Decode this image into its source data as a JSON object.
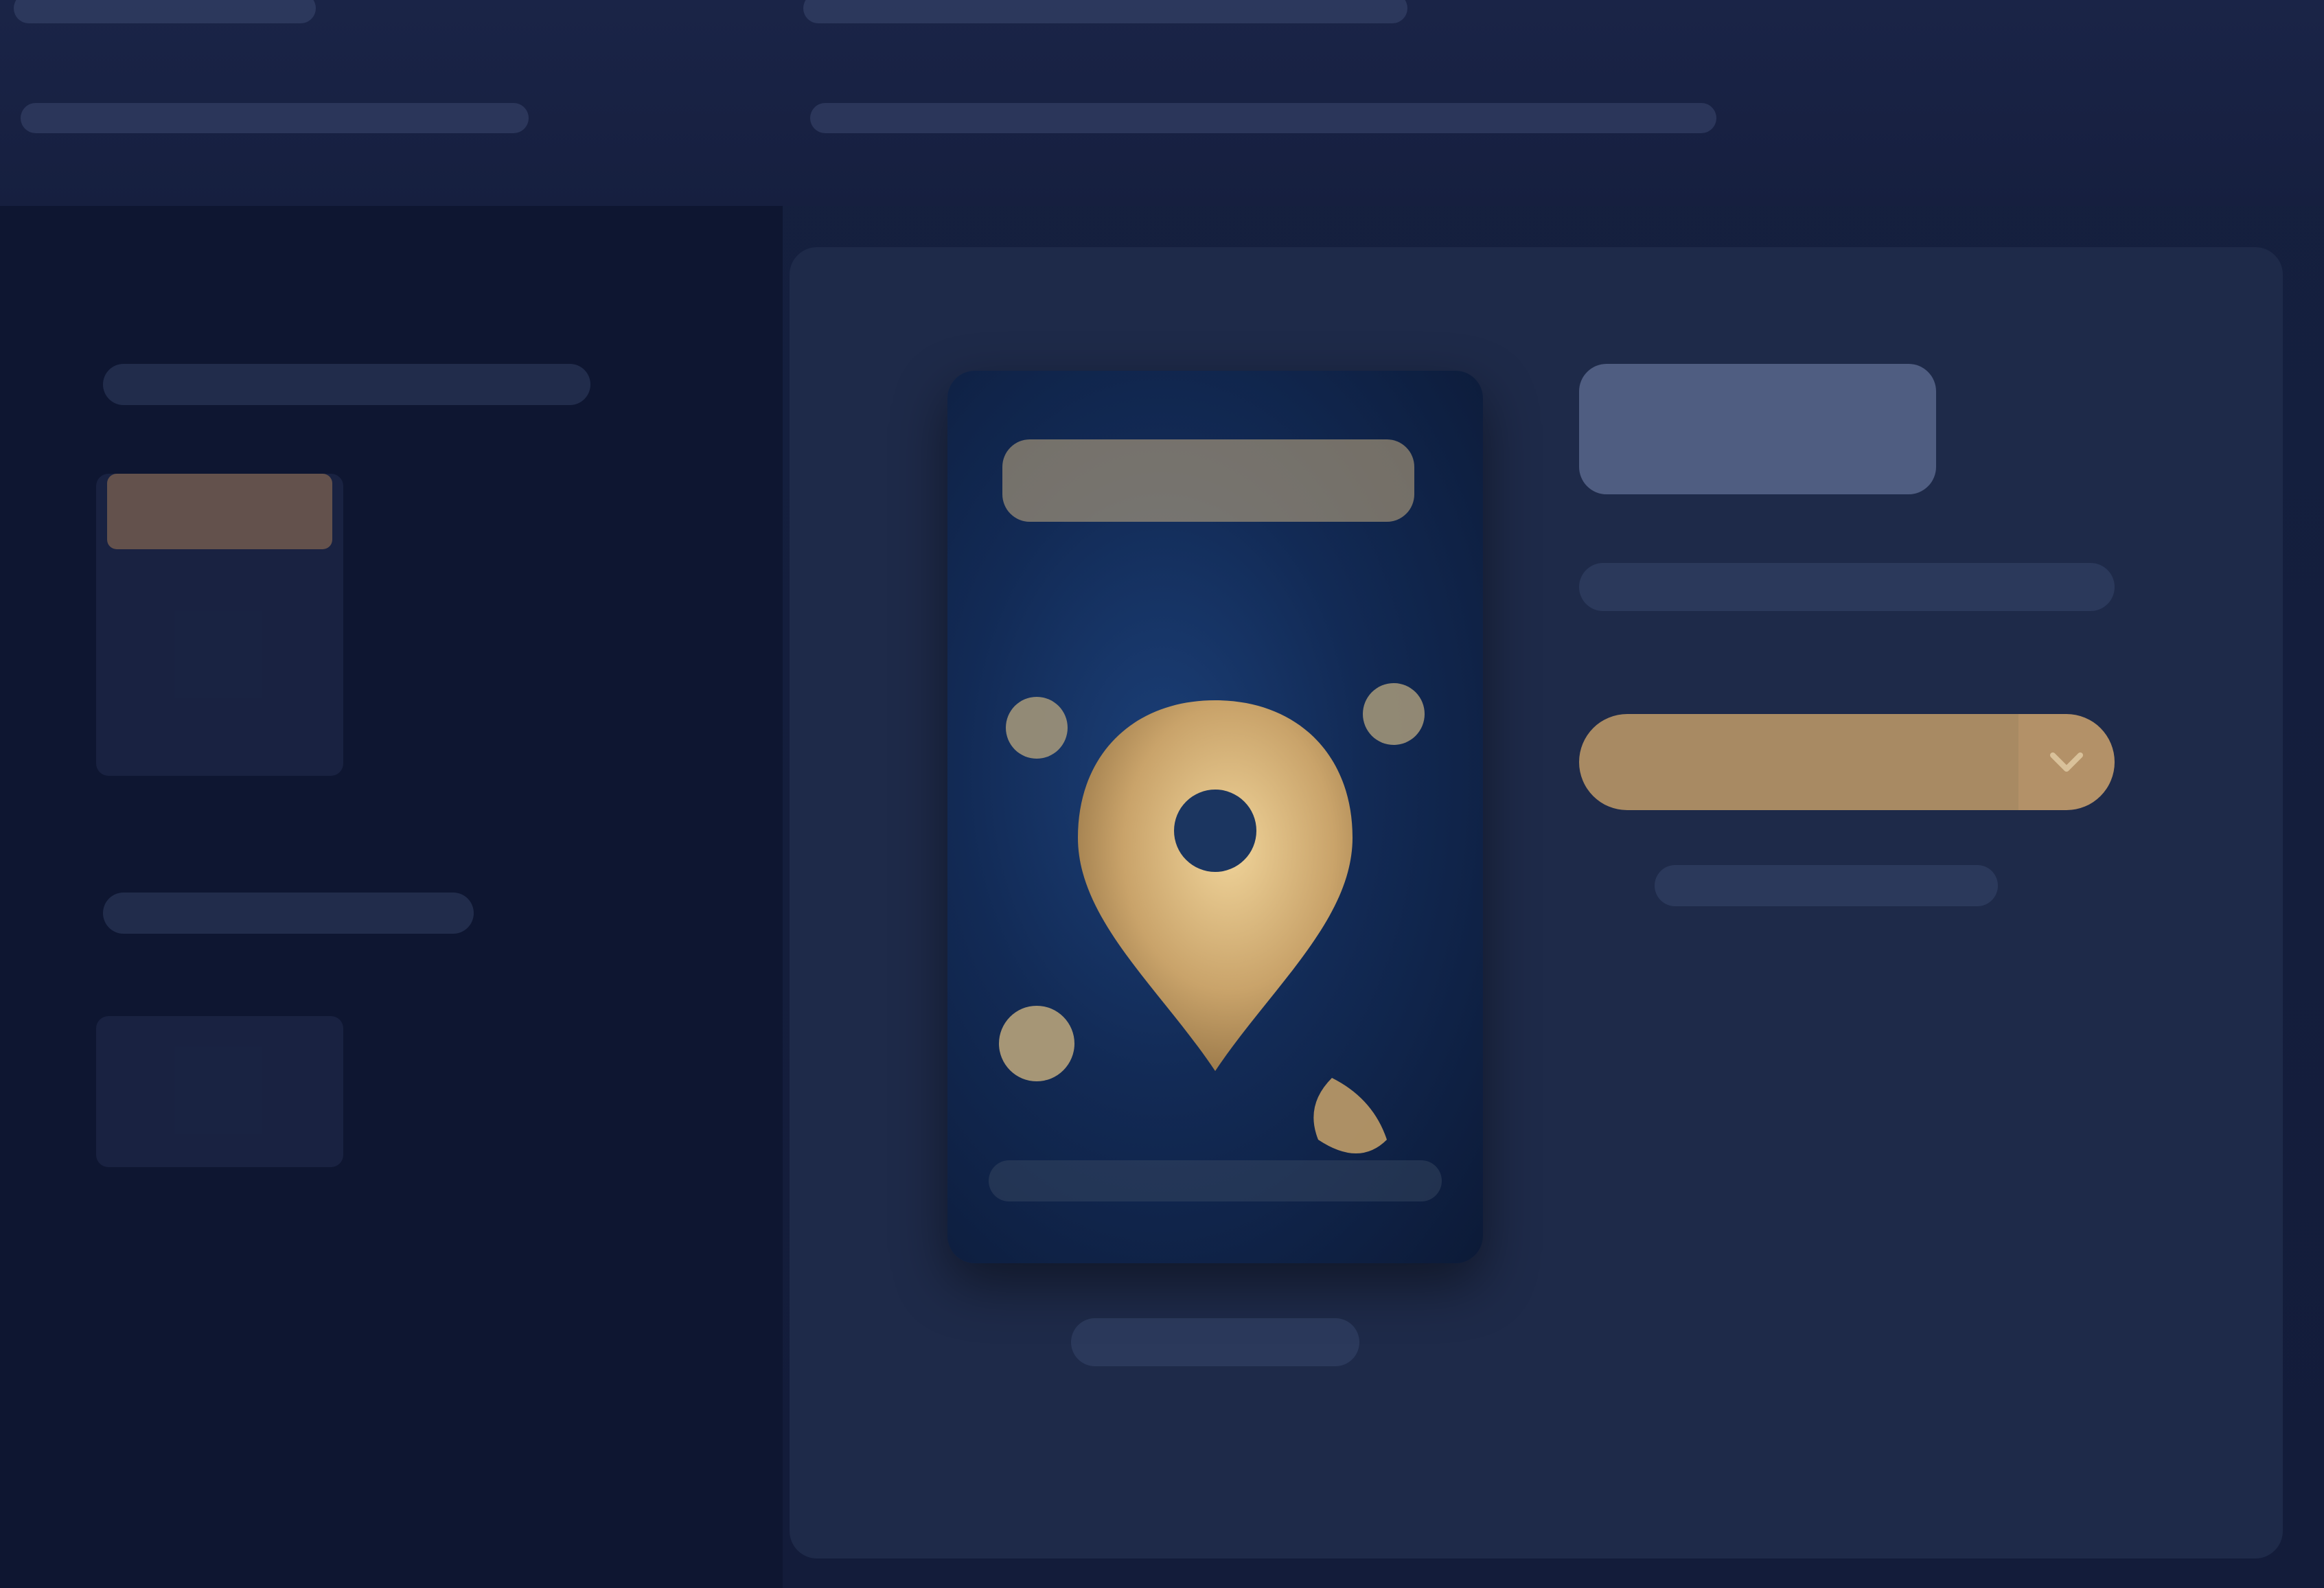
{
  "colors": {
    "background": "#131c3a",
    "sidebar": "#0e1631",
    "card": "#1e2a49",
    "accent_gold": "#a88a63",
    "cover_blue": "#1b3f77"
  },
  "icons": {
    "cover_art": "location-pin-icon",
    "buy_dropdown": "chevron-down-icon"
  }
}
